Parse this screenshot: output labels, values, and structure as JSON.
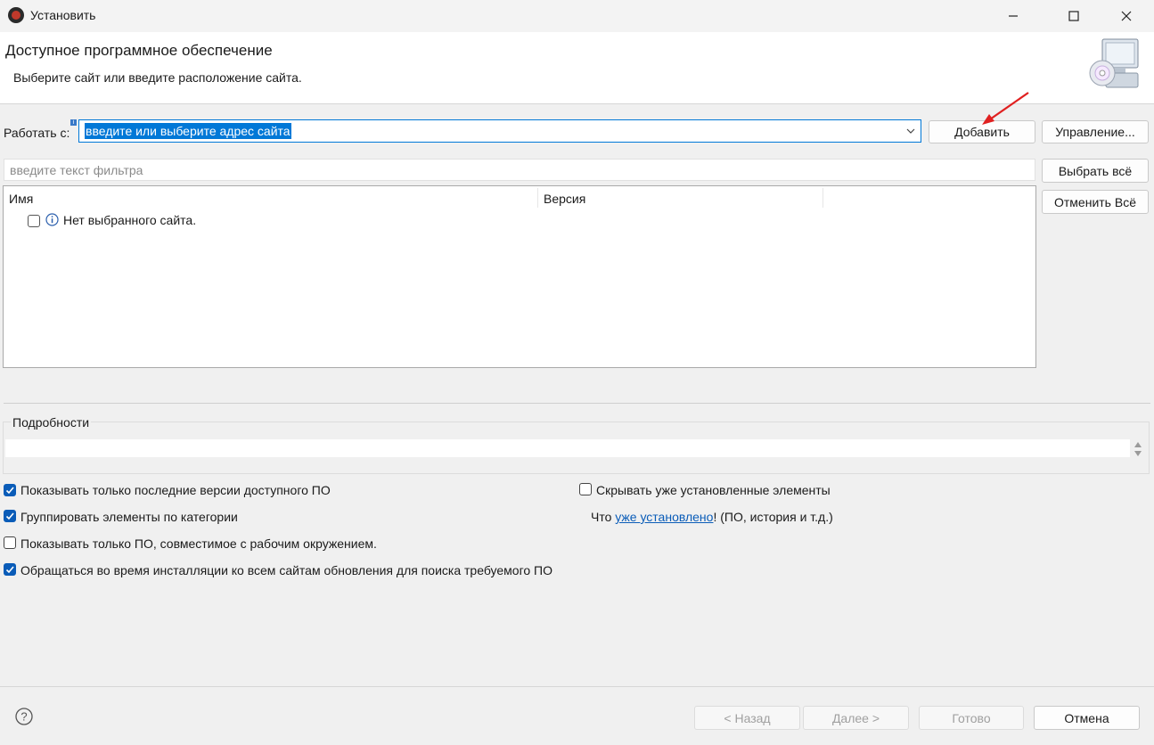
{
  "window": {
    "title": "Установить",
    "minimize_glyph": "—",
    "maximize_glyph": "☐",
    "close_glyph": "✕"
  },
  "header": {
    "title": "Доступное программное обеспечение",
    "subtitle": "Выберите сайт или введите расположение сайта.",
    "icon": "cd-monitor-icon"
  },
  "work_with": {
    "label": "Работать с:",
    "value": "введите или выберите адрес сайта",
    "add_button": "Добавить",
    "manage_button": "Управление..."
  },
  "filter": {
    "placeholder": "введите текст фильтра"
  },
  "buttons": {
    "select_all": "Выбрать всё",
    "deselect_all": "Отменить Всё"
  },
  "table": {
    "columns": [
      "Имя",
      "Версия"
    ],
    "rows": [
      {
        "label": "Нет выбранного сайта.",
        "checked": false,
        "icon": "info-icon"
      }
    ]
  },
  "details": {
    "label": "Подробности"
  },
  "options": {
    "latest_only": {
      "label": "Показывать только последние версии доступного ПО",
      "checked": true
    },
    "group_by_category": {
      "label": "Группировать элементы по категории",
      "checked": true
    },
    "compatible_only": {
      "label": "Показывать только ПО, совместимое с рабочим окружением.",
      "checked": false
    },
    "contact_all_sites": {
      "label": "Обращаться во время инсталляции ко всем сайтам обновления для поиска требуемого ПО",
      "checked": true
    },
    "hide_installed": {
      "label": "Скрывать уже установленные элементы",
      "checked": false
    },
    "what_prefix": "Что",
    "installed_link": "уже установлено",
    "what_suffix": "! (ПО, история и т.д.)"
  },
  "footer": {
    "back": "< Назад",
    "next": "Далее >",
    "finish": "Готово",
    "cancel": "Отмена"
  },
  "colors": {
    "accent": "#0078d7",
    "checkbox": "#0a5cb8",
    "annotation_arrow": "#e02020"
  }
}
